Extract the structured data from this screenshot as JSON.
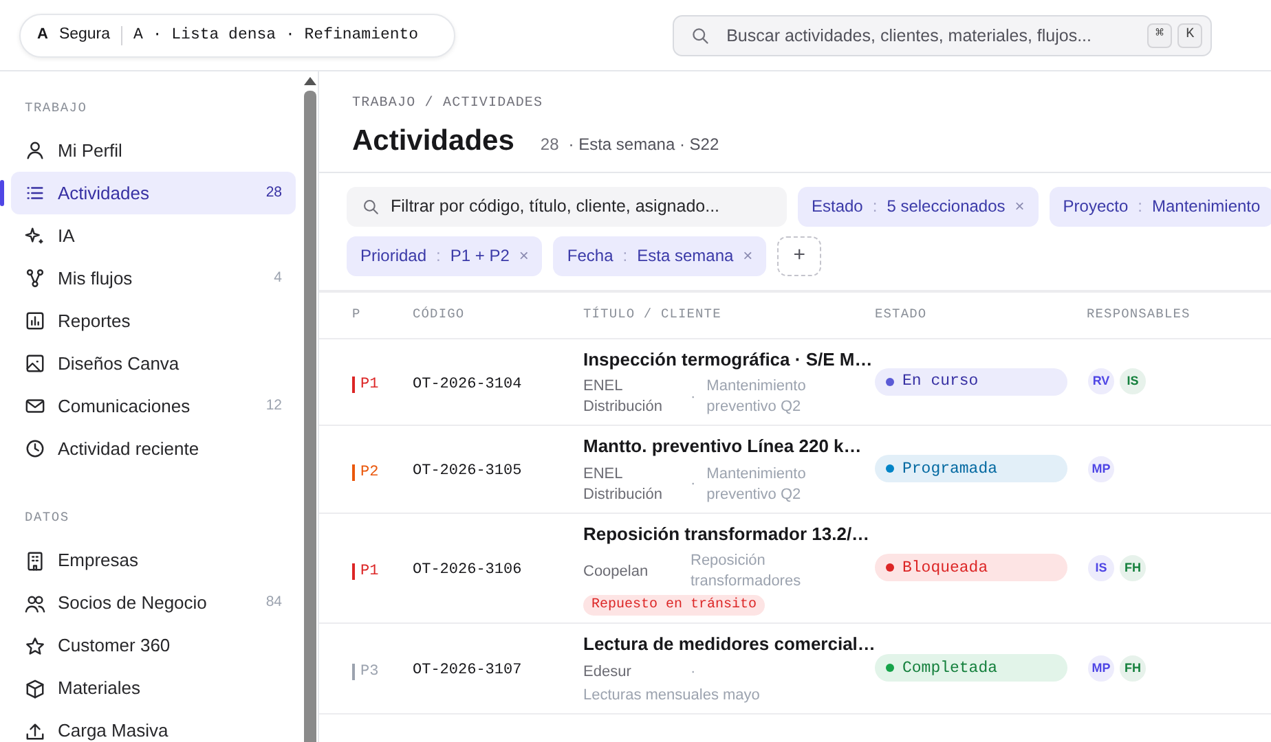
{
  "workspace_pill": {
    "initial": "A",
    "name": "Segura",
    "variant": "A · Lista densa · Refinamiento"
  },
  "global_search": {
    "placeholder": "Buscar actividades, clientes, materiales, flujos...",
    "shortcut": [
      "⌘",
      "K"
    ]
  },
  "sidebar": {
    "sections": [
      {
        "title": "TRABAJO",
        "items": [
          {
            "label": "Mi Perfil",
            "selected": false
          },
          {
            "label": "Actividades",
            "count": "28",
            "selected": true
          },
          {
            "label": "IA",
            "selected": false
          },
          {
            "label": "Mis flujos",
            "count": "4",
            "selected": false
          },
          {
            "label": "Reportes",
            "selected": false
          },
          {
            "label": "Diseños Canva",
            "selected": false
          },
          {
            "label": "Comunicaciones",
            "count": "12",
            "selected": false
          },
          {
            "label": "Actividad reciente",
            "selected": false
          }
        ]
      },
      {
        "title": "DATOS",
        "items": [
          {
            "label": "Empresas",
            "selected": false
          },
          {
            "label": "Socios de Negocio",
            "count": "84",
            "selected": false
          },
          {
            "label": "Customer 360",
            "selected": false
          },
          {
            "label": "Materiales",
            "selected": false
          },
          {
            "label": "Carga Masiva",
            "selected": false
          }
        ]
      }
    ]
  },
  "breadcrumb": "TRABAJO / ACTIVIDADES",
  "page_title": "Actividades",
  "page_count": "28",
  "page_period": "· Esta semana · S22",
  "filter_search": {
    "placeholder": "Filtrar por código, título, cliente, asignado..."
  },
  "filters": [
    {
      "label": "Estado",
      "separator": ":",
      "value": "5 seleccionados",
      "remove": "×"
    },
    {
      "label": "Proyecto",
      "separator": ":",
      "value": "Mantenimiento"
    },
    {
      "label": "Prioridad",
      "separator": ":",
      "value": "P1 + P2",
      "remove": "×"
    },
    {
      "label": "Fecha",
      "separator": ":",
      "value": "Esta semana",
      "remove": "×"
    }
  ],
  "add_filter": "+",
  "table": {
    "columns": [
      "P",
      "CÓDIGO",
      "TÍTULO / CLIENTE",
      "ESTADO",
      "RESPONSABLES"
    ],
    "rows": [
      {
        "priority": {
          "label": "P1",
          "color": "#dc2626"
        },
        "code": "OT-2026-3104",
        "title": "Inspección termográfica · S/E M…",
        "client": "ENEL Distribución",
        "separator": "·",
        "project": "Mantenimiento preventivo Q2",
        "status": {
          "label": "En curso",
          "kind": "in_progress"
        },
        "assignees": [
          {
            "initials": "RV",
            "color": "#4f46e5"
          },
          {
            "initials": "IS",
            "color": "#15803d"
          }
        ]
      },
      {
        "priority": {
          "label": "P2",
          "color": "#ea580c"
        },
        "code": "OT-2026-3105",
        "title": "Mantto. preventivo Línea 220 k…",
        "client": "ENEL Distribución",
        "separator": "·",
        "project": "Mantenimiento preventivo Q2",
        "status": {
          "label": "Programada",
          "kind": "scheduled"
        },
        "assignees": [
          {
            "initials": "MP",
            "color": "#4f46e5"
          }
        ]
      },
      {
        "priority": {
          "label": "P1",
          "color": "#dc2626"
        },
        "code": "OT-2026-3106",
        "title": "Reposición transformador 13.2/…",
        "client": "Coopelan",
        "project": "Reposición transformadores",
        "tag": "Repuesto en tránsito",
        "status": {
          "label": "Bloqueada",
          "kind": "blocked"
        },
        "assignees": [
          {
            "initials": "IS",
            "color": "#4f46e5"
          },
          {
            "initials": "FH",
            "color": "#15803d"
          }
        ]
      },
      {
        "priority": {
          "label": "P3",
          "color": "#9ca3af"
        },
        "code": "OT-2026-3107",
        "title": "Lectura de medidores comercial…",
        "client": "Edesur",
        "separator": "·",
        "project": "Lecturas mensuales mayo",
        "status": {
          "label": "Completada",
          "kind": "done"
        },
        "assignees": [
          {
            "initials": "MP",
            "color": "#4f46e5"
          },
          {
            "initials": "FH",
            "color": "#15803d"
          }
        ]
      }
    ]
  }
}
